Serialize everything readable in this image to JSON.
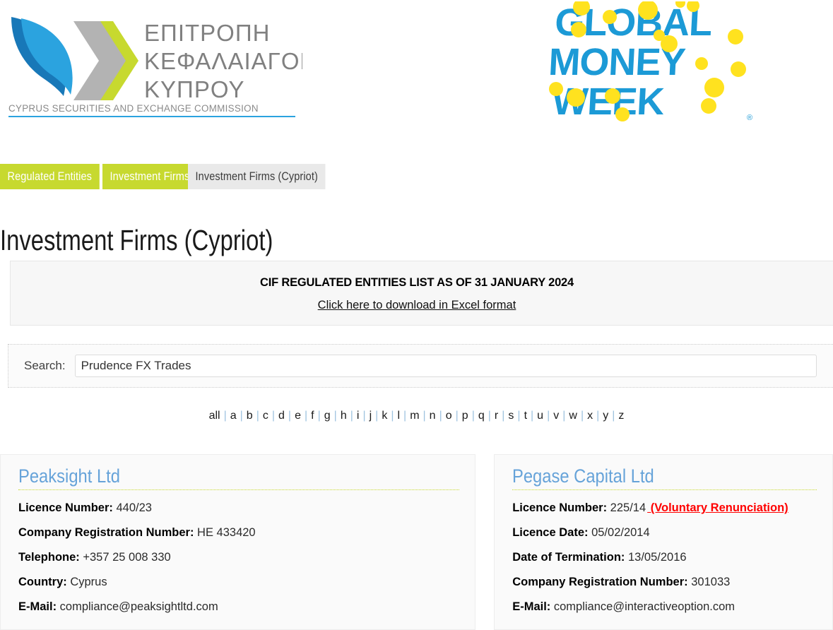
{
  "header": {
    "cysec_logo": {
      "alt": "cysec-logo",
      "line1": "ΕΠΙΤΡΟΠΗ",
      "line2": "ΚΕΦΑΛΑΙΑΓΟΡΑΣ",
      "line3": "ΚΥΠΡΟΥ",
      "subtitle": "CYPRUS SECURITIES AND EXCHANGE COMMISSION"
    },
    "gmw_logo": {
      "alt": "global-money-week-logo",
      "line1": "GLOBAL",
      "line2": "MONEY",
      "line3": "WEEK",
      "registered_mark": "®"
    }
  },
  "breadcrumb": {
    "items": [
      {
        "label": "Regulated Entities",
        "state": "active"
      },
      {
        "label": "Investment Firms",
        "state": "active"
      },
      {
        "label": "Investment Firms (Cypriot)",
        "state": "current"
      }
    ]
  },
  "page": {
    "title": "Investment Firms (Cypriot)"
  },
  "info_panel": {
    "title": "CIF REGULATED ENTITIES LIST AS OF 31 JANUARY 2024",
    "download_link": "Click here to download in Excel format"
  },
  "search": {
    "label": "Search:",
    "value": "Prudence FX Trades",
    "placeholder": ""
  },
  "alpha_filter": {
    "separator": "|",
    "items": [
      "all",
      "a",
      "b",
      "c",
      "d",
      "e",
      "f",
      "g",
      "h",
      "i",
      "j",
      "k",
      "l",
      "m",
      "n",
      "o",
      "p",
      "q",
      "r",
      "s",
      "t",
      "u",
      "v",
      "w",
      "x",
      "y",
      "z"
    ]
  },
  "results": [
    {
      "name": "Peaksight Ltd",
      "flag": null,
      "fields": [
        {
          "key": "Licence Number",
          "sep": ": ",
          "value": "440/23"
        },
        {
          "key": "Company Registration Number",
          "sep": ": ",
          "value": "HE 433420"
        },
        {
          "key": "Telephone",
          "sep": ": ",
          "value": "+357 25 008 330"
        },
        {
          "key": "Country",
          "sep": ": ",
          "value": "Cyprus"
        },
        {
          "key": "E-Mail",
          "sep": ": ",
          "value": "compliance@peaksightltd.com"
        }
      ]
    },
    {
      "name": "Pegase Capital Ltd",
      "flag": "(Voluntary Renunciation)",
      "fields": [
        {
          "key": "Licence Number",
          "sep": ": ",
          "value": "225/14"
        },
        {
          "key": "Licence Date:",
          "sep": " ",
          "value": "05/02/2014"
        },
        {
          "key": "Date of Termination",
          "sep": ": ",
          "value": "13/05/2016"
        },
        {
          "key": "Company Registration Number",
          "sep": ": ",
          "value": "301033"
        },
        {
          "key": "E-Mail",
          "sep": ": ",
          "value": "compliance@interactiveoption.com"
        }
      ]
    }
  ],
  "colors": {
    "brand_green": "#c7d92f",
    "brand_blue": "#1c9ad6",
    "title_blue": "#66a3d9",
    "flag_red": "#ff0000",
    "logo_gray": "#808080"
  }
}
